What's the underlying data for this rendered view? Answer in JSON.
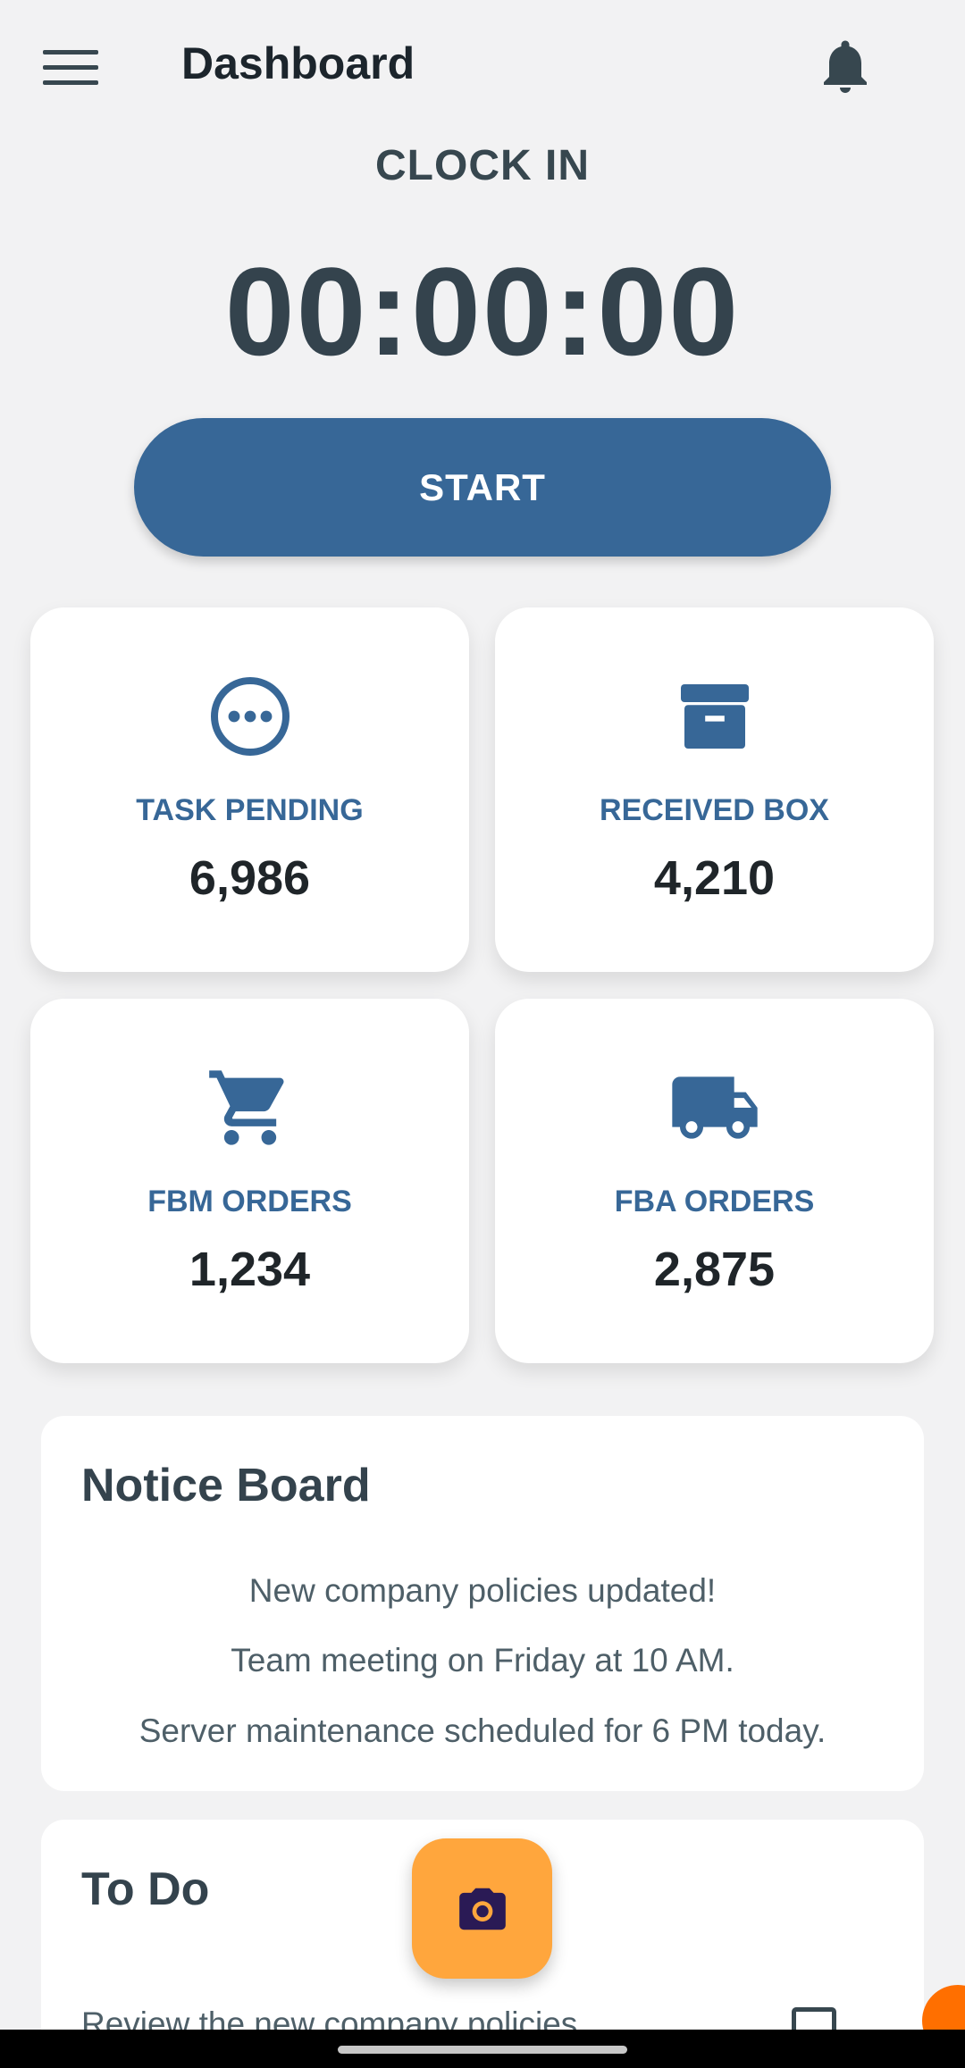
{
  "header": {
    "title": "Dashboard",
    "menu_icon": "hamburger-menu-icon",
    "notification_icon": "bell-icon"
  },
  "clock": {
    "label": "CLOCK IN",
    "time": "00:00:00",
    "start_label": "START",
    "button_color": "#376797"
  },
  "stats": [
    {
      "icon": "ellipsis-circle-icon",
      "label": "TASK PENDING",
      "value": "6,986"
    },
    {
      "icon": "archive-box-icon",
      "label": "RECEIVED BOX",
      "value": "4,210"
    },
    {
      "icon": "shopping-cart-icon",
      "label": "FBM ORDERS",
      "value": "1,234"
    },
    {
      "icon": "truck-icon",
      "label": "FBA ORDERS",
      "value": "2,875"
    }
  ],
  "notice_board": {
    "title": "Notice Board",
    "items": [
      "New company policies updated!",
      "Team meeting on Friday at 10 AM.",
      "Server maintenance scheduled for 6 PM today."
    ]
  },
  "todo": {
    "title": "To Do",
    "items": [
      {
        "text": "Review the new company policies",
        "checked": false
      }
    ]
  },
  "fab": {
    "icon": "camera-icon",
    "color": "#ffa63d"
  },
  "colors": {
    "accent": "#376797",
    "background": "#f2f2f3",
    "fab": "#ffa63d"
  }
}
